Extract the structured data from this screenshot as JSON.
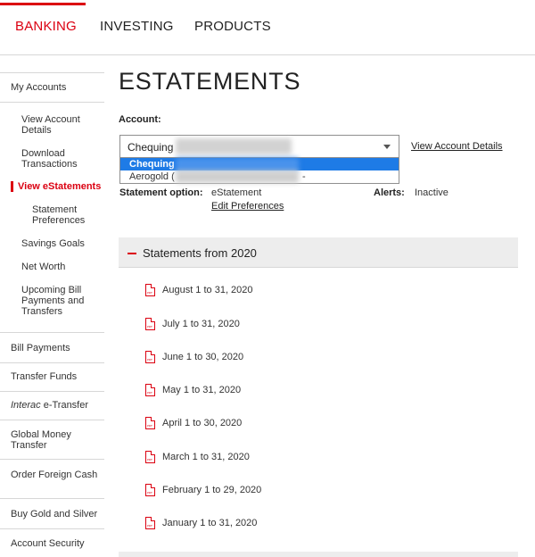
{
  "nav": {
    "tabs": [
      {
        "label": "BANKING"
      },
      {
        "label": "INVESTING"
      },
      {
        "label": "PRODUCTS"
      }
    ]
  },
  "sidebar": {
    "my_accounts": "My Accounts",
    "view_account_details": "View Account Details",
    "download_transactions": "Download Transactions",
    "view_estatements": "View eStatements",
    "statement_preferences": "Statement Preferences",
    "savings_goals": "Savings Goals",
    "net_worth": "Net Worth",
    "upcoming_bill": "Upcoming Bill Payments and Transfers",
    "bill_payments": "Bill Payments",
    "transfer_funds": "Transfer Funds",
    "interac_italic": "Interac",
    "interac_rest": " e-Transfer",
    "global_money": "Global Money Transfer",
    "order_foreign_cash": "Order Foreign Cash",
    "buy_gold_silver": "Buy Gold and Silver",
    "account_security": "Account Security"
  },
  "main": {
    "title": "ESTATEMENTS",
    "account_label": "Account:",
    "select_value": "Chequing",
    "options": [
      {
        "label": "Chequing",
        "selected": true
      },
      {
        "label": "Aerogold (",
        "selected": false
      }
    ],
    "option_tail": "-",
    "view_account_details": "View Account Details",
    "statement_option_label": "Statement option:",
    "statement_option_value": "eStatement",
    "edit_preferences": "Edit Preferences",
    "alerts_label": "Alerts:",
    "alerts_value": "Inactive",
    "year_header": "Statements from 2020",
    "pdf_icon_text": "PDF",
    "statements": [
      "August 1 to 31, 2020",
      "July 1 to 31, 2020",
      "June 1 to 30, 2020",
      "May 1 to 31, 2020",
      "April 1 to 30, 2020",
      "March 1 to 31, 2020",
      "February 1 to 29, 2020",
      "January 1 to 31, 2020"
    ]
  },
  "colors": {
    "accent": "#db0011",
    "selection": "#1e7be6",
    "header_bg": "#ededed"
  }
}
